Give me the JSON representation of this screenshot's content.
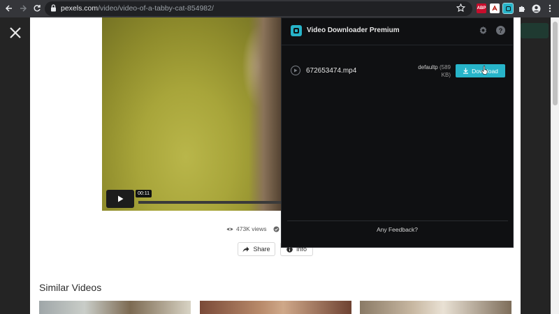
{
  "browser": {
    "url_domain": "pexels.com",
    "url_path": "/video/video-of-a-tabby-cat-854982/",
    "extensions": [
      {
        "name": "adblock-icon",
        "label": "ABP",
        "color": "#c70d2c"
      },
      {
        "name": "pdf-icon",
        "label": "",
        "color": "#b30b00"
      },
      {
        "name": "video-downloader-icon",
        "label": "",
        "color": "#27b4c9"
      }
    ]
  },
  "video": {
    "time": "00:11"
  },
  "stats": {
    "views": "473K views"
  },
  "actions": {
    "share_label": "Share",
    "info_label": "Info"
  },
  "similar": {
    "title": "Similar Videos"
  },
  "popup": {
    "title": "Video Downloader Premium",
    "file": {
      "name": "672653474.mp4",
      "quality": "defaultp",
      "size": "(589 KB)",
      "download_label": "Download"
    },
    "feedback_label": "Any Feedback?"
  },
  "colors": {
    "accent": "#27b4c9",
    "popup_bg": "#0f1012"
  }
}
